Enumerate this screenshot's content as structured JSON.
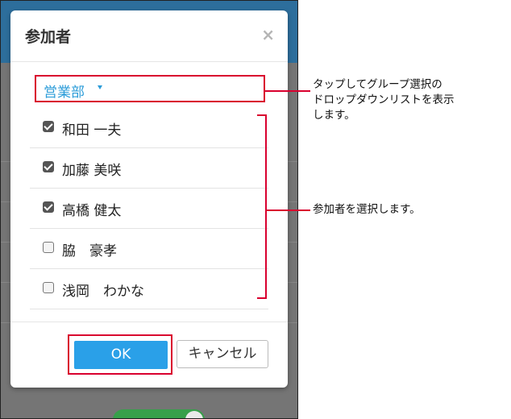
{
  "dialog": {
    "title": "参加者",
    "close_symbol": "×",
    "group_dropdown": {
      "selected": "営業部"
    },
    "participants": [
      {
        "name": "和田 一夫",
        "checked": true
      },
      {
        "name": "加藤 美咲",
        "checked": true
      },
      {
        "name": "高橋 健太",
        "checked": true
      },
      {
        "name": "脇　豪孝",
        "checked": false
      },
      {
        "name": "浅岡　わかな",
        "checked": false
      }
    ],
    "ok_label": "OK",
    "cancel_label": "キャンセル"
  },
  "annotations": {
    "dropdown_note_line1": "タップしてグループ選択の",
    "dropdown_note_line2": "ドロップダウンリストを表示",
    "dropdown_note_line3": "します。",
    "participants_note": "参加者を選択します。"
  },
  "colors": {
    "accent": "#2aa0e8",
    "highlight": "#d9002e",
    "link": "#2a9bd8"
  }
}
